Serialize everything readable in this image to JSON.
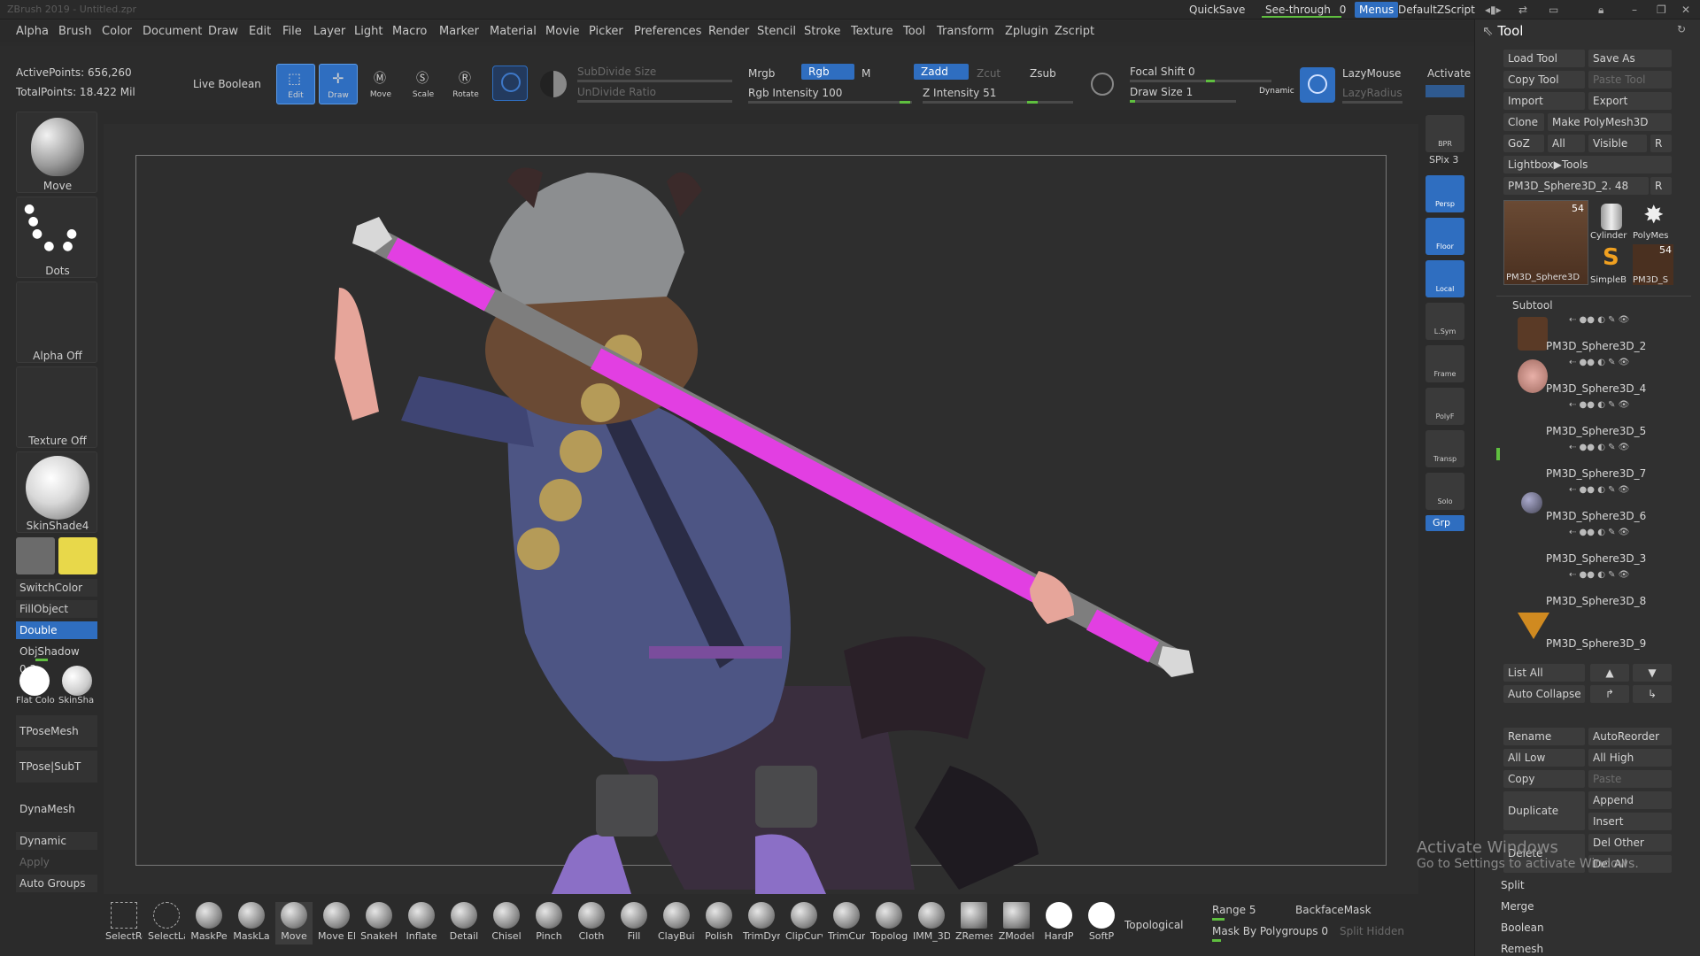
{
  "titlebar": {
    "title": "ZBrush 2019 - Untitled.zpr",
    "quicksave": "QuickSave",
    "seethrough_label": "See-through",
    "seethrough_value": "0",
    "menus": "Menus",
    "script": "DefaultZScript"
  },
  "menubar": [
    "Alpha",
    "Brush",
    "Color",
    "Document",
    "Draw",
    "Edit",
    "File",
    "Layer",
    "Light",
    "Macro",
    "Marker",
    "Material",
    "Movie",
    "Picker",
    "Preferences",
    "Render",
    "Stencil",
    "Stroke",
    "Texture",
    "Tool",
    "Transform",
    "Zplugin",
    "Zscript"
  ],
  "stats": {
    "active_points": "ActivePoints: 656,260",
    "total_points": "TotalPoints: 18.422 Mil"
  },
  "shelf": {
    "live_boolean": "Live Boolean",
    "tools": [
      {
        "label": "Edit",
        "active": true
      },
      {
        "label": "Draw",
        "active": true
      },
      {
        "label": "Move",
        "active": false
      },
      {
        "label": "Scale",
        "active": false
      },
      {
        "label": "Rotate",
        "active": false
      }
    ],
    "subdivide_size": "SubDivide Size",
    "undivide_ratio": "UnDivide Ratio",
    "mrgb": "Mrgb",
    "rgb": "Rgb",
    "m": "M",
    "zadd": "Zadd",
    "zcut": "Zcut",
    "zsub": "Zsub",
    "rgb_intensity": "Rgb Intensity 100",
    "z_intensity": "Z Intensity 51",
    "focal_shift": "Focal Shift 0",
    "draw_size": "Draw Size 1",
    "dynamic": "Dynamic",
    "lazymouse": "LazyMouse",
    "lazyradius": "LazyRadius",
    "activate": "Activate"
  },
  "left_panel": {
    "brush": "Move",
    "stroke": "Dots",
    "alpha": "Alpha Off",
    "texture": "Texture Off",
    "material": "SkinShade4",
    "switchcolor": "SwitchColor",
    "fillobject": "FillObject",
    "double": "Double",
    "objshadow": "ObjShadow 0.3",
    "flatcolor": "Flat Colo",
    "skinsha": "SkinSha",
    "tposemesh": "TPoseMesh",
    "tpose_subt": "TPose|SubT",
    "dynamesh": "DynaMesh",
    "dynamic": "Dynamic",
    "apply": "Apply",
    "auto_groups": "Auto Groups"
  },
  "right_dock": [
    {
      "label": "BPR",
      "active": false
    },
    {
      "label": "SPix 3",
      "active": false
    },
    {
      "label": "Persp",
      "active": true
    },
    {
      "label": "Floor",
      "active": true
    },
    {
      "label": "Local",
      "active": true
    },
    {
      "label": "L.Sym",
      "active": false
    },
    {
      "label": "Frame",
      "active": false
    },
    {
      "label": "PolyF",
      "active": false
    },
    {
      "label": "Transp",
      "active": false
    },
    {
      "label": "Solo",
      "active": false
    },
    {
      "label": "Grp",
      "active": true
    }
  ],
  "tool_panel": {
    "title": "Tool",
    "buttons": [
      [
        "Load Tool",
        "Save As"
      ],
      [
        "Copy Tool",
        "Paste Tool"
      ],
      [
        "Import",
        "Export"
      ],
      [
        "Clone",
        "Make PolyMesh3D"
      ],
      [
        "GoZ",
        "All",
        "Visible",
        "R"
      ]
    ],
    "lightbox": "Lightbox▶Tools",
    "current_tool": "PM3D_Sphere3D_2. 48",
    "r": "R",
    "thumbs": [
      "PM3D_Sphere3D",
      "Cylinder",
      "PolyMes",
      "SimpleB",
      "PM3D_S"
    ],
    "thumb_count_a": "54",
    "thumb_count_b": "54",
    "subtool_header": "Subtool",
    "subtools": [
      "PM3D_Sphere3D_2",
      "PM3D_Sphere3D_4",
      "PM3D_Sphere3D_5",
      "PM3D_Sphere3D_7",
      "PM3D_Sphere3D_6",
      "PM3D_Sphere3D_3",
      "PM3D_Sphere3D_8",
      "PM3D_Sphere3D_9"
    ],
    "list_all": "List All",
    "auto_collapse": "Auto Collapse",
    "actions": [
      [
        "Rename",
        "AutoReorder"
      ],
      [
        "All Low",
        "All High"
      ],
      [
        "Copy",
        "Paste"
      ],
      [
        "Duplicate",
        "Append"
      ],
      [
        "",
        "Insert"
      ],
      [
        "Delete",
        "Del Other"
      ],
      [
        "",
        "Del All"
      ]
    ],
    "split": "Split",
    "merge": "Merge",
    "boolean": "Boolean",
    "remesh": "Remesh"
  },
  "bottom_shelf": {
    "brushes": [
      "SelectRe",
      "SelectLa",
      "MaskPe",
      "MaskLa",
      "Move",
      "Move El",
      "SnakeH",
      "Inflate",
      "Detail",
      "Chisel",
      "Pinch",
      "Cloth",
      "Fill",
      "ClayBuil",
      "Polish",
      "TrimDyn",
      "ClipCurv",
      "TrimCur",
      "Topolog",
      "IMM_3D",
      "ZRemes",
      "ZModel",
      "HardP",
      "SoftP"
    ],
    "topological": "Topological",
    "range": "Range 5",
    "backfacemask": "BackfaceMask",
    "mask_by_polygroups": "Mask By Polygroups 0",
    "split_hidden": "Split Hidden"
  },
  "watermark": {
    "title": "Activate Windows",
    "subtitle": "Go to Settings to activate Windows."
  }
}
